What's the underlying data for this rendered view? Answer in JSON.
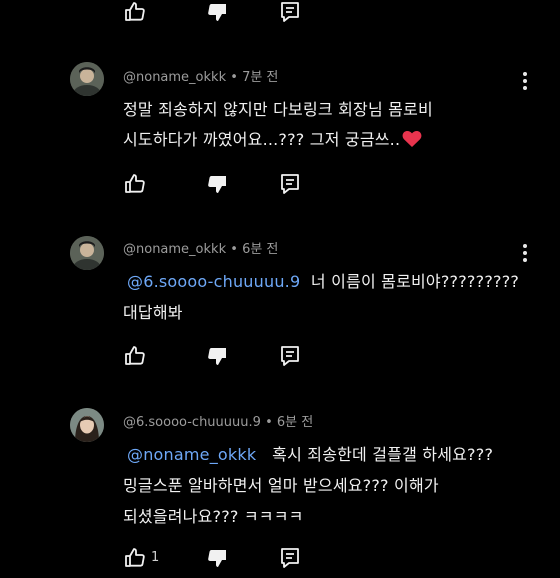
{
  "comments": [
    {
      "handle": "@noname_okkk",
      "sep": "•",
      "time": "7분 전",
      "lines": [
        "정말 죄송하지 않지만 다보링크 회장님 몸로비",
        "시도하다가 까였어요...??? 그저 궁금쓰.."
      ],
      "emoji": "heart"
    },
    {
      "handle": "@noname_okkk",
      "sep": "•",
      "time": "6분 전",
      "mention": "@6.soooo-chuuuuu.9",
      "lines": [
        "너 이름이 몸로비야?????????",
        "대답해봐"
      ]
    },
    {
      "handle": "@6.soooo-chuuuuu.9",
      "sep": "•",
      "time": "6분 전",
      "mention": "@noname_okkk",
      "lines": [
        "혹시 죄송한데 걸플갤 하세요???",
        "밍글스푼 알바하면서 얼마 받으세요??? 이해가",
        "되셨을려나요??? ㅋㅋㅋㅋ"
      ]
    }
  ],
  "bottom_like_count": "1",
  "icons": {
    "like": "thumbs-up-icon",
    "dislike": "thumbs-down-icon",
    "reply": "reply-icon",
    "more": "more-vert-icon"
  },
  "colors": {
    "background": "#000000",
    "text": "#f1f1f1",
    "meta": "#9c9c9c",
    "mention": "#6ea8f7",
    "heart": "#e8344e"
  }
}
